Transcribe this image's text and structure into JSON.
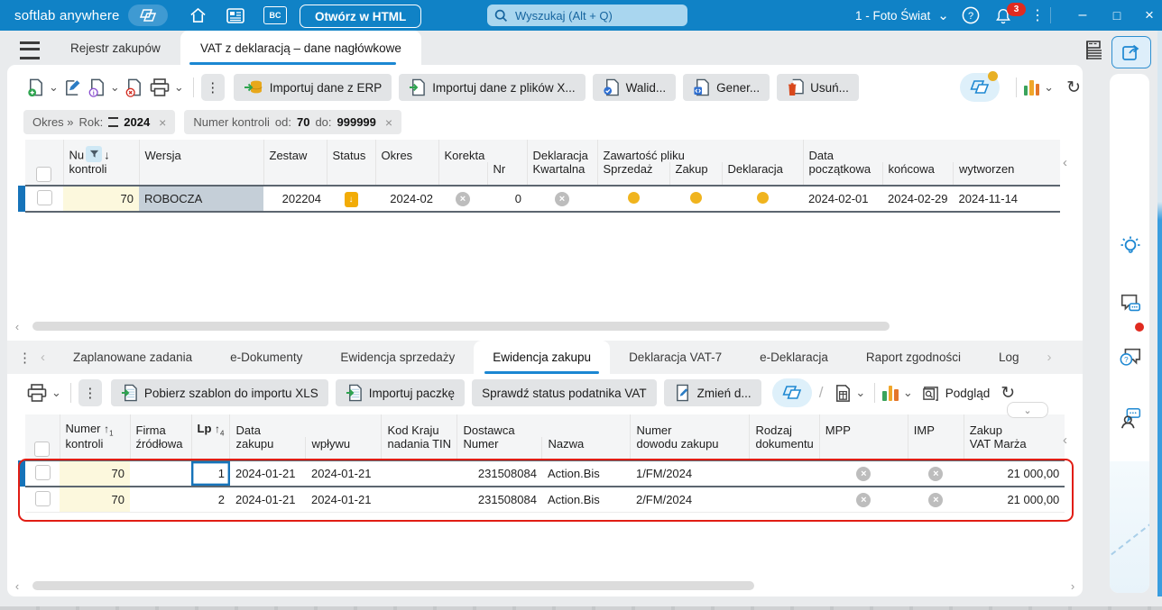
{
  "titlebar": {
    "brand": "softlab anywhere",
    "bc_label": "BC",
    "open_html_button": "Otwórz w HTML",
    "search_placeholder": "Wyszukaj (Alt + Q)",
    "company_selector": "1 - Foto Świat",
    "notification_count": "3"
  },
  "icons": {
    "chevron_down": "⌄",
    "chevron_left": "‹",
    "chevron_right": "›",
    "kebab": "⋮",
    "sort_desc": "↓",
    "sort_asc": "↑",
    "close_x": "×",
    "minimize": "–",
    "maximize": "□",
    "close": "×",
    "refresh": "↻",
    "slash": "/",
    "x_mark": "×",
    "help": "?",
    "status_draft_glyph": "↓"
  },
  "tabs": {
    "tab1": "Rejestr zakupów",
    "tab2": "VAT z deklaracją – dane nagłówkowe"
  },
  "toolbar1": {
    "btn_import_erp": "Importuj dane z ERP",
    "btn_import_files": "Importuj dane z plików X...",
    "btn_walid": "Walid...",
    "btn_gener": "Gener...",
    "btn_usun": "Usuń..."
  },
  "filters": {
    "chip1_path": "Okres »",
    "chip1_field": "Rok:",
    "chip1_value": "2024",
    "chip2_label": "Numer kontroli",
    "chip2_od": "od:",
    "chip2_od_value": "70",
    "chip2_do": "do:",
    "chip2_do_value": "999999"
  },
  "grid1": {
    "h_numer_1": "Nu",
    "h_numer_2": "kontroli",
    "h_wersja": "Wersja",
    "h_zestaw": "Zestaw",
    "h_status": "Status",
    "h_okres": "Okres",
    "h_korekta": "Korekta",
    "h_nr": "Nr",
    "h_deklaracja": "Deklaracja",
    "h_kwartalna": "Kwartalna",
    "h_zawartosc_pliku": "Zawartość pliku",
    "h_sprzedaz": "Sprzedaż",
    "h_zakup": "Zakup",
    "h_deklaracja2": "Deklaracja",
    "h_data": "Data",
    "h_poczatkowa": "początkowa",
    "h_koncowa": "końcowa",
    "h_wytworzenia": "wytworzen",
    "row": {
      "numer_kontroli": "70",
      "wersja": "ROBOCZA",
      "zestaw": "202204",
      "okres": "2024-02",
      "korekta_nr": "0",
      "data_poczatkowa": "2024-02-01",
      "data_koncowa": "2024-02-29",
      "data_wytworzenia": "2024-11-14"
    }
  },
  "subtabs": {
    "t1": "Zaplanowane zadania",
    "t2": "e-Dokumenty",
    "t3": "Ewidencja sprzedaży",
    "t4": "Ewidencja zakupu",
    "t5": "Deklaracja VAT-7",
    "t6": "e-Deklaracja",
    "t7": "Raport zgodności",
    "t8": "Log"
  },
  "toolbar2": {
    "btn_szablon_xls": "Pobierz szablon do importu XLS",
    "btn_importuj_paczke": "Importuj paczkę",
    "btn_status_vat": "Sprawdź status podatnika VAT",
    "btn_zmien": "Zmień d...",
    "btn_podglad": "Podgląd"
  },
  "grid2": {
    "h_numer_1": "Numer",
    "h_numer_2": "kontroli",
    "sort_numer_order": "1",
    "h_firma_1": "Firma",
    "h_firma_2": "źródłowa",
    "h_lp": "Lp",
    "sort_lp_order": "4",
    "h_data": "Data",
    "h_zakupu": "zakupu",
    "h_wplywu": "wpływu",
    "h_kod_1": "Kod Kraju",
    "h_kod_2": "nadania TIN",
    "h_dostawca": "Dostawca",
    "h_dostawca_numer": "Numer",
    "h_dostawca_nazwa": "Nazwa",
    "h_dowod_1": "Numer",
    "h_dowod_2": "dowodu zakupu",
    "h_rodzaj_1": "Rodzaj",
    "h_rodzaj_2": "dokumentu",
    "h_mpp": "MPP",
    "h_imp": "IMP",
    "h_zakup_1": "Zakup",
    "h_zakup_2": "VAT Marża",
    "rows": [
      {
        "numer_kontroli": "70",
        "lp": "1",
        "data_zakupu": "2024-01-21",
        "data_wplywu": "2024-01-21",
        "dostawca_numer": "231508084",
        "dostawca_nazwa": "Action.Bis",
        "numer_dowodu": "1/FM/2024",
        "zakup_vat_marza": "21 000,00"
      },
      {
        "numer_kontroli": "70",
        "lp": "2",
        "data_zakupu": "2024-01-21",
        "data_wplywu": "2024-01-21",
        "dostawca_numer": "231508084",
        "dostawca_nazwa": "Action.Bis",
        "numer_dowodu": "2/FM/2024",
        "zakup_vat_marza": "21 000,00"
      }
    ]
  },
  "colors": {
    "titlebar_blue": "#1082c6",
    "accent_blue": "#1b87d2",
    "annotation_red": "#e11d14",
    "status_amber": "#f2ac07",
    "selected_row_border": "#5c6670"
  }
}
